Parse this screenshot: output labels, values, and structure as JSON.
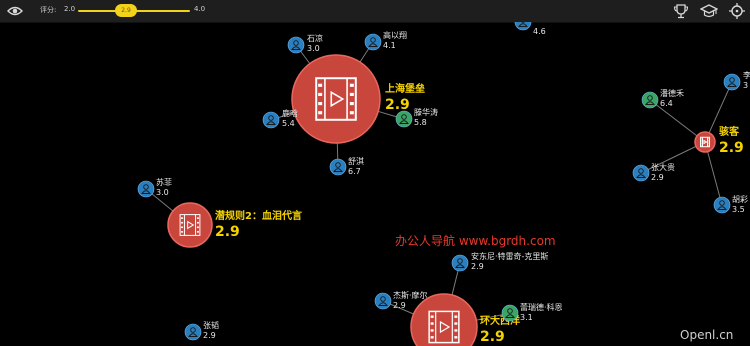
{
  "toolbar": {
    "rating_label": "评分:",
    "rating_min": "2.0",
    "rating_max": "4.0",
    "rating_value": "2.9",
    "icons": [
      "eye-icon",
      "trophy-icon",
      "graduation-cap-icon",
      "crosshair-icon"
    ]
  },
  "colors": {
    "background": "#000000",
    "toolbar": "#1e1e1e",
    "accent": "#f2d21b",
    "movie_node": "#c9463d",
    "person_blue": "#2a7fc0",
    "person_green": "#3aa564",
    "edge": "#7a7a7a"
  },
  "movies": [
    {
      "title": "上海堡垒",
      "score": "2.9"
    },
    {
      "title": "潜规则2：血泪代言",
      "score": "2.9"
    },
    {
      "title": "环大西洋",
      "score": "2.9"
    },
    {
      "title": "骇客",
      "score": "2.9"
    }
  ],
  "people": [
    {
      "name": "石凉",
      "score": "3.0",
      "color": "blue"
    },
    {
      "name": "高以翔",
      "score": "4.1",
      "color": "blue"
    },
    {
      "name": "鹿晗",
      "score": "5.4",
      "color": "blue"
    },
    {
      "name": "滕华涛",
      "score": "5.8",
      "color": "green"
    },
    {
      "name": "舒淇",
      "score": "6.7",
      "color": "blue"
    },
    {
      "name": "苏菲",
      "score": "3.0",
      "color": "blue"
    },
    {
      "name": "潘德禾",
      "score": "6.4",
      "color": "green"
    },
    {
      "name": "张大贵",
      "score": "2.9",
      "color": "blue"
    },
    {
      "name": "胡彩",
      "score": "3.5",
      "color": "blue"
    },
    {
      "name": "李",
      "score": "3",
      "color": "blue"
    },
    {
      "name": "安东尼·特雷奇-克里斯",
      "score": "2.9",
      "color": "blue"
    },
    {
      "name": "杰斯·摩尔",
      "score": "2.9",
      "color": "blue"
    },
    {
      "name": "蕾瑞德·科恩",
      "score": "3.1",
      "color": "green"
    },
    {
      "name": "张韬",
      "score": "2.9",
      "color": "blue"
    },
    {
      "name": "",
      "score": "4.6",
      "color": "blue"
    }
  ],
  "watermark": "办公人导航 www.bgrdh.com",
  "corner_watermark": "Openl.cn"
}
